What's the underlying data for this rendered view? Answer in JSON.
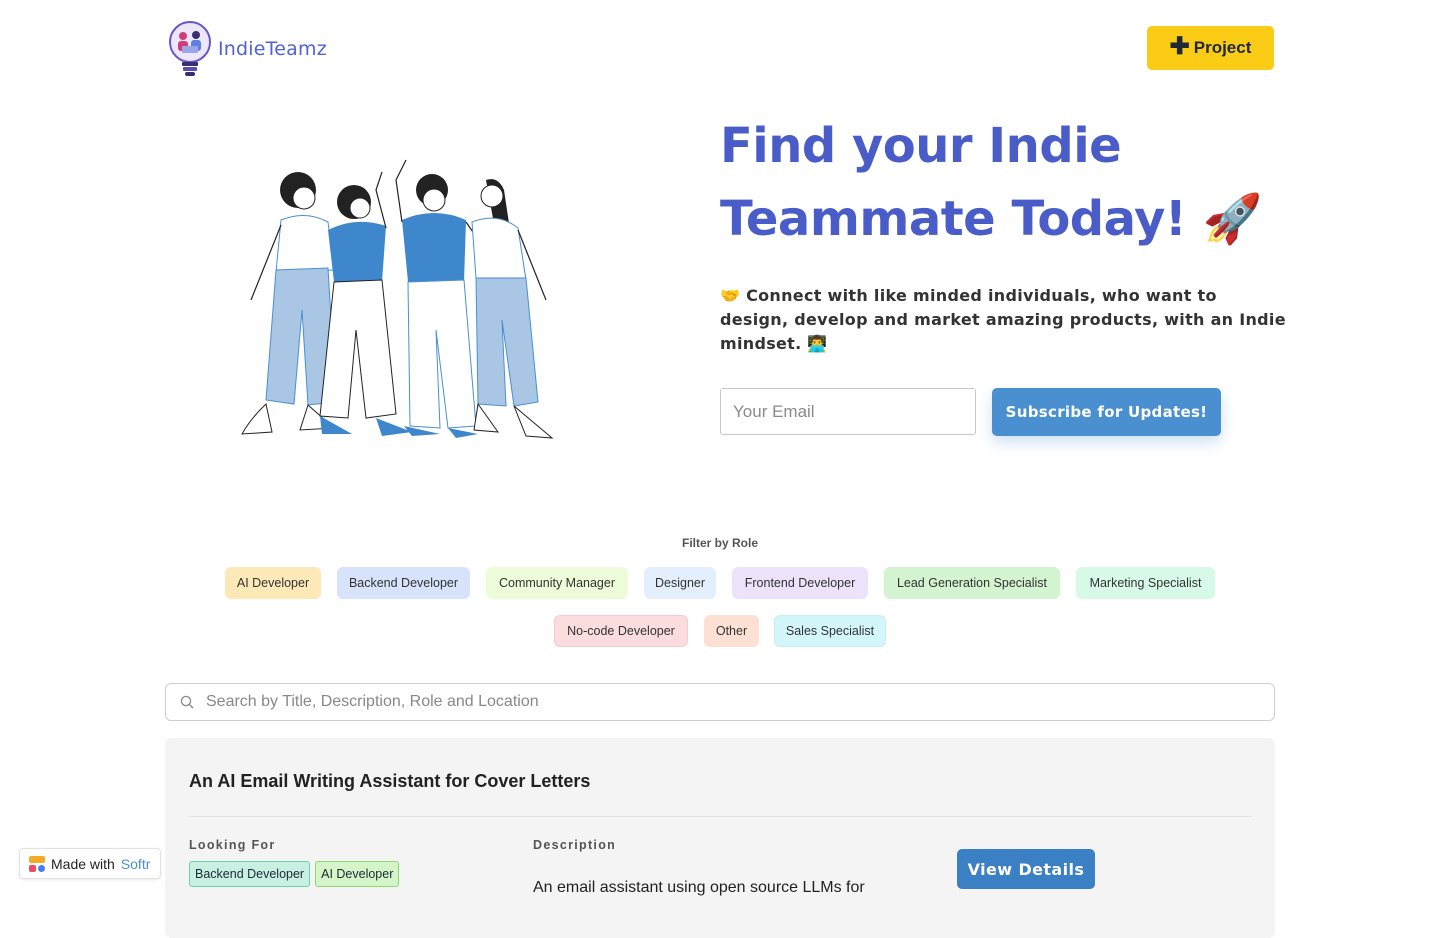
{
  "header": {
    "logo_text": "IndieTeamz",
    "project_button_label": "Project",
    "project_button_icon": "plus-icon"
  },
  "hero": {
    "title": "Find your Indie Teammate Today! 🚀",
    "subtitle": "🤝 Connect with like minded individuals, who want to design, develop and market amazing products, with an Indie mindset. 👨‍💻",
    "email_placeholder": "Your Email",
    "email_value": "",
    "subscribe_label": "Subscribe for Updates!",
    "illustration": "team-high-five-illustration"
  },
  "filter": {
    "label": "Filter by Role",
    "roles": [
      {
        "label": "AI Developer",
        "bg": "#fde9b8",
        "border": "#fde9b8"
      },
      {
        "label": "Backend Developer",
        "bg": "#d7e3fb",
        "border": "#d7e3fb"
      },
      {
        "label": "Community Manager",
        "bg": "#eefbd8",
        "border": "#eefbd8"
      },
      {
        "label": "Designer",
        "bg": "#e3effd",
        "border": "#e3effd"
      },
      {
        "label": "Frontend Developer",
        "bg": "#ece3fb",
        "border": "#ece3fb"
      },
      {
        "label": "Lead Generation Specialist",
        "bg": "#d4f4d1",
        "border": "#d4f4d1"
      },
      {
        "label": "Marketing Specialist",
        "bg": "#d7fae8",
        "border": "#d7fae8"
      },
      {
        "label": "No-code Developer",
        "bg": "#fbdde0",
        "border": "#f8c9cf"
      },
      {
        "label": "Other",
        "bg": "#fde0d4",
        "border": "#fde0d4"
      },
      {
        "label": "Sales Specialist",
        "bg": "#d3f6fb",
        "border": "#c4eff6"
      }
    ]
  },
  "search": {
    "placeholder": "Search by Title, Description, Role and Location",
    "value": ""
  },
  "card": {
    "title": "An AI Email Writing Assistant for Cover Letters",
    "looking_for_label": "Looking For",
    "tags": [
      {
        "label": "Backend Developer",
        "bg": "#c7f0e3",
        "border": "#6fd0b0"
      },
      {
        "label": "AI Developer",
        "bg": "#d5f5c9",
        "border": "#8ad86f"
      }
    ],
    "description_label": "Description",
    "description": "An email assistant using open source LLMs for",
    "view_button_label": "View Details"
  },
  "badge": {
    "prefix": "Made with",
    "brand": "Softr"
  }
}
